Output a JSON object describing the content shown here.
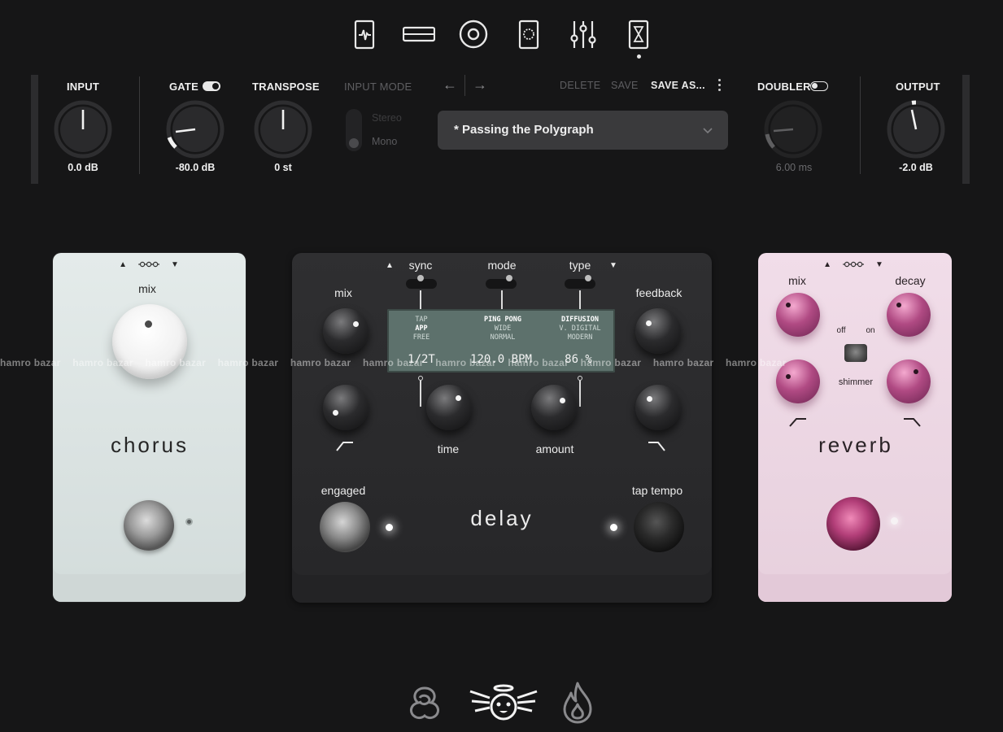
{
  "top_nav": {
    "icons": [
      "tuner-icon",
      "eq-bar-icon",
      "target-icon",
      "amp-icon",
      "mixer-sliders-icon",
      "hourglass-icon"
    ],
    "active_index": 5
  },
  "header": {
    "input": {
      "label": "INPUT",
      "value": "0.0 dB"
    },
    "gate": {
      "label": "GATE",
      "value": "-80.0 dB",
      "enabled": true
    },
    "transpose": {
      "label": "TRANSPOSE",
      "value": "0 st"
    },
    "input_mode": {
      "label": "INPUT MODE",
      "options": [
        "Stereo",
        "Mono"
      ],
      "selected": "Mono"
    },
    "preset": {
      "back_arrow": "←",
      "forward_arrow": "→",
      "delete_label": "DELETE",
      "save_label": "SAVE",
      "save_as_label": "SAVE AS...",
      "name": "* Passing the Polygraph"
    },
    "doubler": {
      "label": "DOUBLER",
      "value": "6.00 ms",
      "enabled": false
    },
    "output": {
      "label": "OUTPUT",
      "value": "-2.0 dB"
    }
  },
  "pedals": {
    "chorus": {
      "title": "chorus",
      "mix_label": "mix",
      "arrow_up": "▲",
      "arrow_down": "▼"
    },
    "delay": {
      "title": "delay",
      "arrow_up": "▲",
      "arrow_down": "▼",
      "sync_label": "sync",
      "mode_label": "mode",
      "type_label": "type",
      "mix_label": "mix",
      "feedback_label": "feedback",
      "time_label": "time",
      "amount_label": "amount",
      "engaged_label": "engaged",
      "tap_tempo_label": "tap tempo",
      "screen": {
        "sync_options": [
          "TAP",
          "APP",
          "FREE"
        ],
        "sync_selected": "APP",
        "mode_options": [
          "PING PONG",
          "WIDE",
          "NORMAL"
        ],
        "mode_selected": "PING PONG",
        "type_options": [
          "DIFFUSION",
          "V. DIGITAL",
          "MODERN"
        ],
        "type_selected": "DIFFUSION",
        "time_readout": "1/2T",
        "tempo_readout": "120.0 BPM",
        "amount_readout": "86 %"
      }
    },
    "reverb": {
      "title": "reverb",
      "mix_label": "mix",
      "decay_label": "decay",
      "shimmer_label": "shimmer",
      "off_label": "off",
      "on_label": "on",
      "arrow_up": "▲",
      "arrow_down": "▼"
    }
  },
  "watermark": "hamro bazar",
  "bottom_nav": {
    "icons": [
      "rose-icon",
      "angel-face-icon",
      "flame-icon"
    ],
    "active_index": 1
  },
  "colors": {
    "background": "#161617",
    "chorus_body": "#dde5e4",
    "delay_body": "#2c2c2e",
    "reverb_body": "#ecd6e3",
    "reverb_knob": "#b04a83",
    "lcd": "#5d716c"
  }
}
